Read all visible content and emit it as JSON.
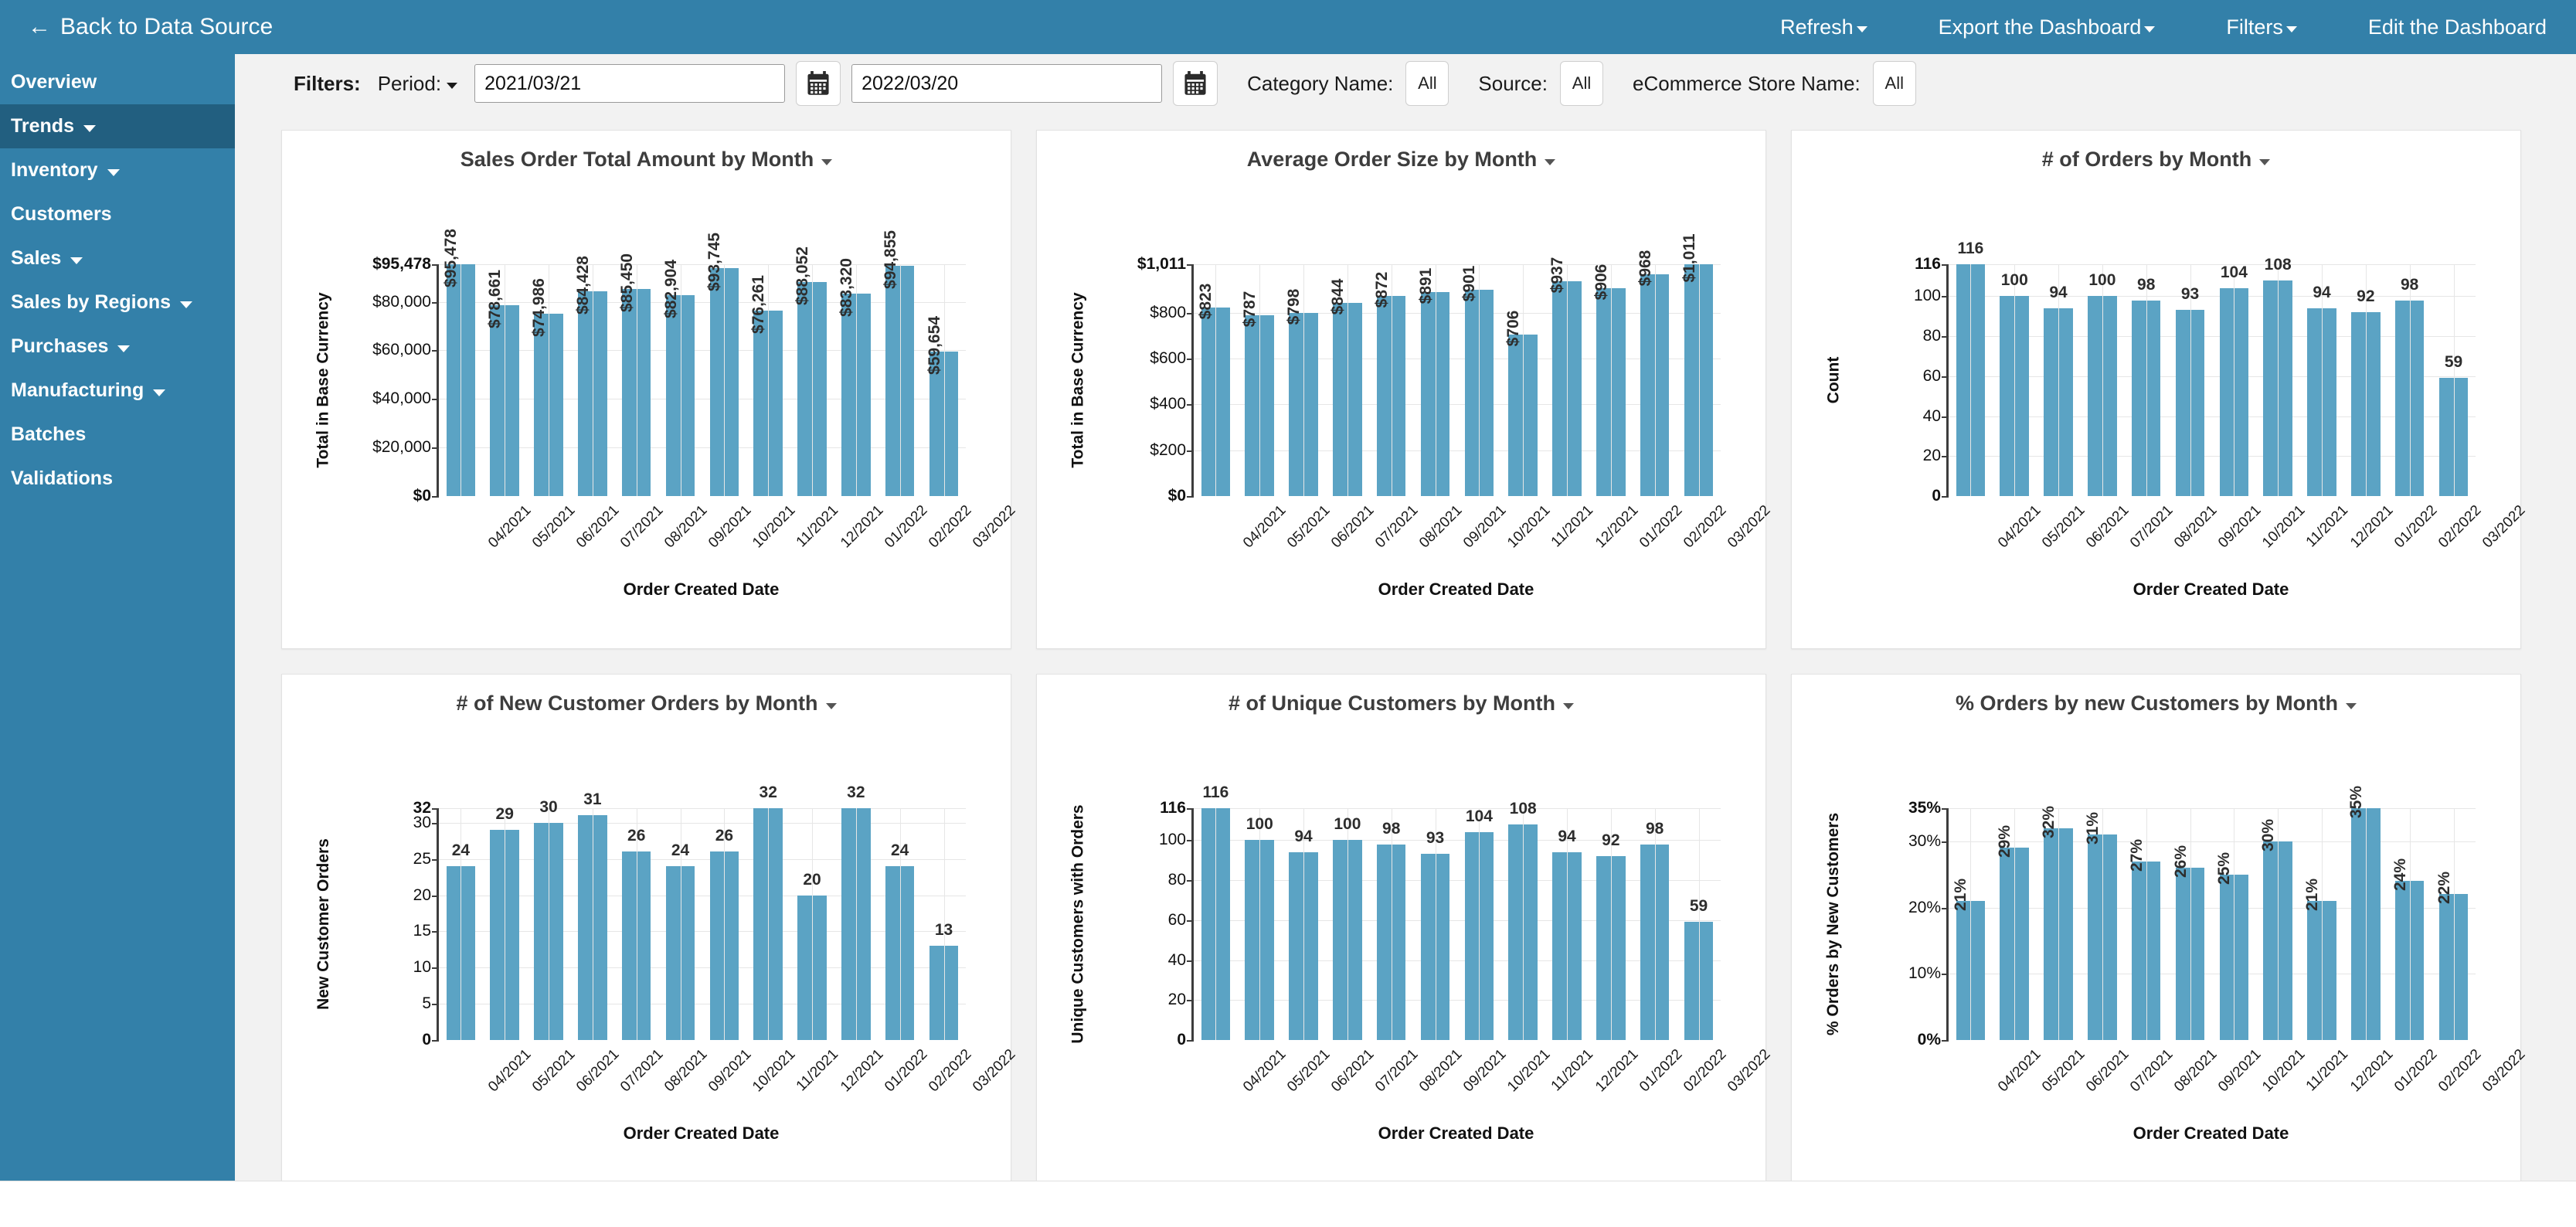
{
  "topbar": {
    "back_label": "Back to Data Source",
    "back_icon": "arrow-left-icon",
    "nav": [
      {
        "label": "Refresh",
        "has_caret": true
      },
      {
        "label": "Export the Dashboard",
        "has_caret": true
      },
      {
        "label": "Filters",
        "has_caret": true
      },
      {
        "label": "Edit the Dashboard",
        "has_caret": false
      }
    ]
  },
  "sidebar": {
    "items": [
      {
        "label": "Overview",
        "has_caret": false,
        "active": false
      },
      {
        "label": "Trends",
        "has_caret": true,
        "active": true
      },
      {
        "label": "Inventory",
        "has_caret": true,
        "active": false
      },
      {
        "label": "Customers",
        "has_caret": false,
        "active": false
      },
      {
        "label": "Sales",
        "has_caret": true,
        "active": false
      },
      {
        "label": "Sales by Regions",
        "has_caret": true,
        "active": false
      },
      {
        "label": "Purchases",
        "has_caret": true,
        "active": false
      },
      {
        "label": "Manufacturing",
        "has_caret": true,
        "active": false
      },
      {
        "label": "Batches",
        "has_caret": false,
        "active": false
      },
      {
        "label": "Validations",
        "has_caret": false,
        "active": false
      }
    ]
  },
  "filters": {
    "label": "Filters:",
    "period_label": "Period:",
    "date_from": "2021/03/21",
    "date_to": "2022/03/20",
    "calendar_icon": "calendar-icon",
    "category_label": "Category Name:",
    "category_value": "All",
    "source_label": "Source:",
    "source_value": "All",
    "store_label": "eCommerce Store Name:",
    "store_value": "All"
  },
  "colors": {
    "brand": "#3380a9",
    "brand_active": "#225f80",
    "bar": "#5ba3c4",
    "panel_bg": "#ffffff",
    "page_bg": "#f2f2f2"
  },
  "chart_data": [
    {
      "id": "sales-order-total-amount-by-month",
      "type": "bar",
      "title": "Sales Order Total Amount by Month",
      "xlabel": "Order Created Date",
      "ylabel": "Total in Base Currency",
      "categories": [
        "04/2021",
        "05/2021",
        "06/2021",
        "07/2021",
        "08/2021",
        "09/2021",
        "10/2021",
        "11/2021",
        "12/2021",
        "01/2022",
        "02/2022",
        "03/2022"
      ],
      "values": [
        95478,
        78661,
        74986,
        84428,
        85450,
        82904,
        93745,
        76261,
        88052,
        83320,
        94855,
        59654
      ],
      "value_labels": [
        "$95,478",
        "$78,661",
        "$74,986",
        "$84,428",
        "$85,450",
        "$82,904",
        "$93,745",
        "$76,261",
        "$88,052",
        "$83,320",
        "$94,855",
        "$59,654"
      ],
      "yticks": [
        0,
        20000,
        40000,
        60000,
        80000,
        95478
      ],
      "ytick_labels": [
        "$0",
        "$20,000",
        "$40,000",
        "$60,000",
        "$80,000",
        "$95,478"
      ],
      "ylim": [
        0,
        95478
      ],
      "grid": true,
      "label_rotation": -90
    },
    {
      "id": "average-order-size-by-month",
      "type": "bar",
      "title": "Average Order Size by Month",
      "xlabel": "Order Created Date",
      "ylabel": "Total in Base Currency",
      "categories": [
        "04/2021",
        "05/2021",
        "06/2021",
        "07/2021",
        "08/2021",
        "09/2021",
        "10/2021",
        "11/2021",
        "12/2021",
        "01/2022",
        "02/2022",
        "03/2022"
      ],
      "values": [
        823,
        787,
        798,
        844,
        872,
        891,
        901,
        706,
        937,
        906,
        968,
        1011
      ],
      "value_labels": [
        "$823",
        "$787",
        "$798",
        "$844",
        "$872",
        "$891",
        "$901",
        "$706",
        "$937",
        "$906",
        "$968",
        "$1,011"
      ],
      "yticks": [
        0,
        200,
        400,
        600,
        800,
        1011
      ],
      "ytick_labels": [
        "$0",
        "$200",
        "$400",
        "$600",
        "$800",
        "$1,011"
      ],
      "ylim": [
        0,
        1011
      ],
      "grid": true,
      "label_rotation": -90
    },
    {
      "id": "number-of-orders-by-month",
      "type": "bar",
      "title": "# of Orders by Month",
      "xlabel": "Order Created Date",
      "ylabel": "Count",
      "categories": [
        "04/2021",
        "05/2021",
        "06/2021",
        "07/2021",
        "08/2021",
        "09/2021",
        "10/2021",
        "11/2021",
        "12/2021",
        "01/2022",
        "02/2022",
        "03/2022"
      ],
      "values": [
        116,
        100,
        94,
        100,
        98,
        93,
        104,
        108,
        94,
        92,
        98,
        59
      ],
      "value_labels": [
        "116",
        "100",
        "94",
        "100",
        "98",
        "93",
        "104",
        "108",
        "94",
        "92",
        "98",
        "59"
      ],
      "yticks": [
        0,
        20,
        40,
        60,
        80,
        100,
        116
      ],
      "ytick_labels": [
        "0",
        "20",
        "40",
        "60",
        "80",
        "100",
        "116"
      ],
      "ylim": [
        0,
        116
      ],
      "grid": true,
      "label_rotation": 0
    },
    {
      "id": "number-of-new-customer-orders-by-month",
      "type": "bar",
      "title": "# of New Customer Orders by Month",
      "xlabel": "Order Created Date",
      "ylabel": "New Customer Orders",
      "categories": [
        "04/2021",
        "05/2021",
        "06/2021",
        "07/2021",
        "08/2021",
        "09/2021",
        "10/2021",
        "11/2021",
        "12/2021",
        "01/2022",
        "02/2022",
        "03/2022"
      ],
      "values": [
        24,
        29,
        30,
        31,
        26,
        24,
        26,
        32,
        20,
        32,
        24,
        13
      ],
      "value_labels": [
        "24",
        "29",
        "30",
        "31",
        "26",
        "24",
        "26",
        "32",
        "20",
        "32",
        "24",
        "13"
      ],
      "yticks": [
        0,
        5,
        10,
        15,
        20,
        25,
        30,
        32
      ],
      "ytick_labels": [
        "0",
        "5",
        "10",
        "15",
        "20",
        "25",
        "30",
        "32"
      ],
      "ylim": [
        0,
        32
      ],
      "grid": true,
      "label_rotation": 0
    },
    {
      "id": "number-of-unique-customers-by-month",
      "type": "bar",
      "title": "# of Unique Customers by Month",
      "xlabel": "Order Created Date",
      "ylabel": "Unique Customers with Orders",
      "categories": [
        "04/2021",
        "05/2021",
        "06/2021",
        "07/2021",
        "08/2021",
        "09/2021",
        "10/2021",
        "11/2021",
        "12/2021",
        "01/2022",
        "02/2022",
        "03/2022"
      ],
      "values": [
        116,
        100,
        94,
        100,
        98,
        93,
        104,
        108,
        94,
        92,
        98,
        59
      ],
      "value_labels": [
        "116",
        "100",
        "94",
        "100",
        "98",
        "93",
        "104",
        "108",
        "94",
        "92",
        "98",
        "59"
      ],
      "yticks": [
        0,
        20,
        40,
        60,
        80,
        100,
        116
      ],
      "ytick_labels": [
        "0",
        "20",
        "40",
        "60",
        "80",
        "100",
        "116"
      ],
      "ylim": [
        0,
        116
      ],
      "grid": true,
      "label_rotation": 0
    },
    {
      "id": "percent-orders-by-new-customers-by-month",
      "type": "bar",
      "title": "% Orders by new Customers by Month",
      "xlabel": "Order Created Date",
      "ylabel": "% Orders by New Customers",
      "categories": [
        "04/2021",
        "05/2021",
        "06/2021",
        "07/2021",
        "08/2021",
        "09/2021",
        "10/2021",
        "11/2021",
        "12/2021",
        "01/2022",
        "02/2022",
        "03/2022"
      ],
      "values": [
        21,
        29,
        32,
        31,
        27,
        26,
        25,
        30,
        21,
        35,
        24,
        22
      ],
      "value_labels": [
        "21%",
        "29%",
        "32%",
        "31%",
        "27%",
        "26%",
        "25%",
        "30%",
        "21%",
        "35%",
        "24%",
        "22%"
      ],
      "yticks": [
        0,
        10,
        20,
        30,
        35
      ],
      "ytick_labels": [
        "0%",
        "10%",
        "20%",
        "30%",
        "35%"
      ],
      "ylim": [
        0,
        35
      ],
      "grid": true,
      "label_rotation": -90
    }
  ]
}
